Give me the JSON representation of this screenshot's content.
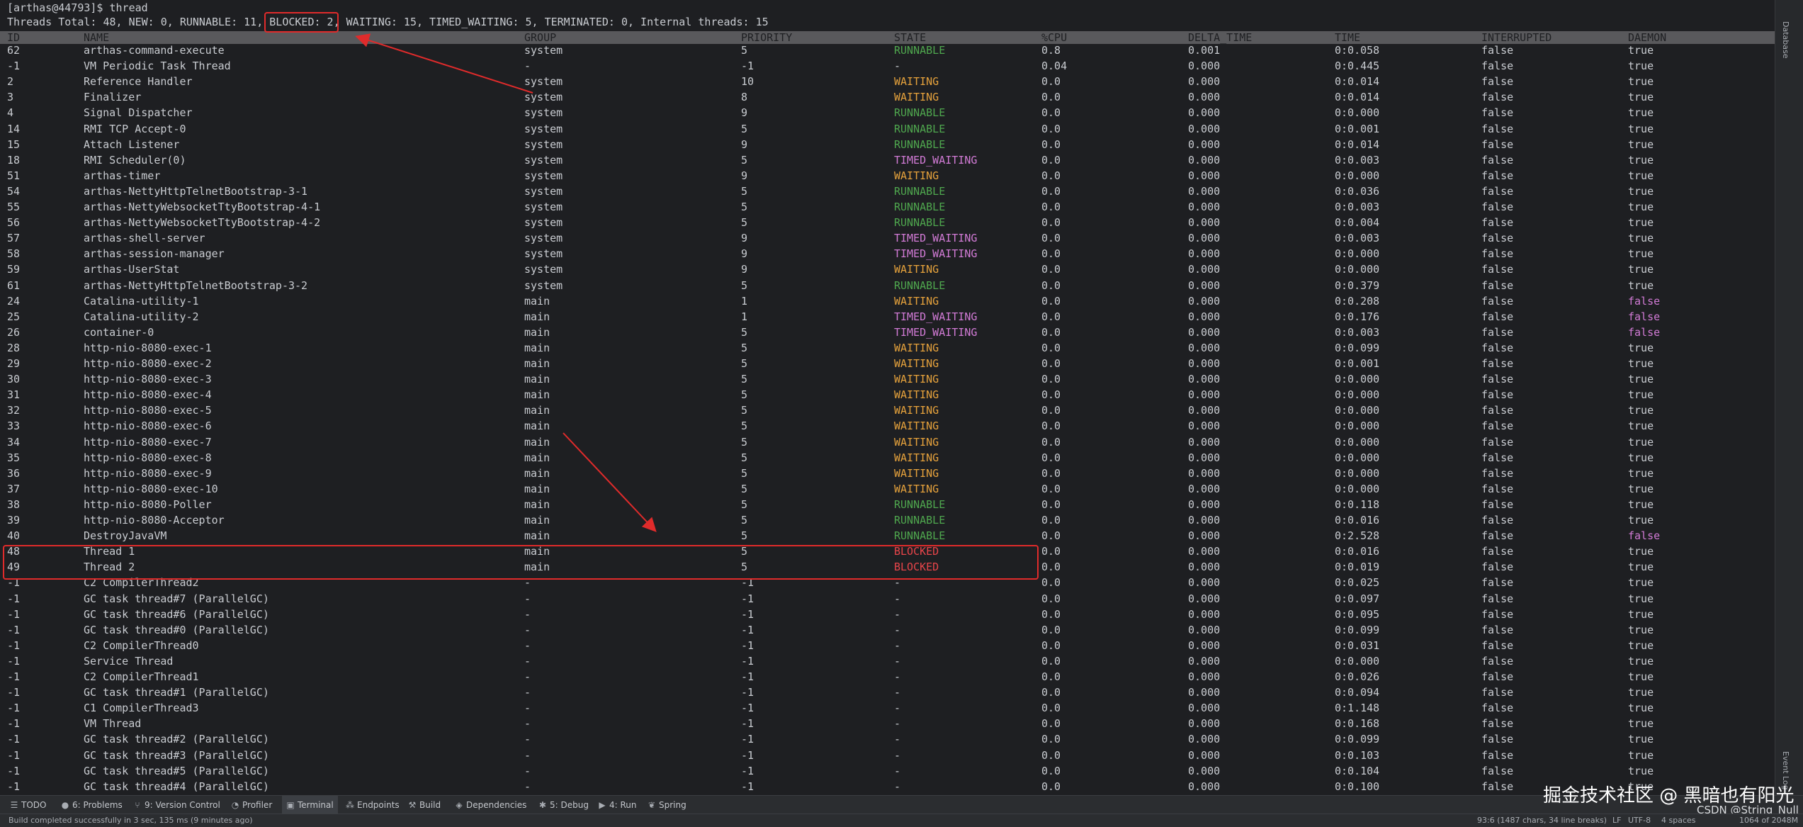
{
  "terminal": {
    "prompt": "[arthas@44793]$ thread",
    "summary": {
      "before": "Threads Total: 48, NEW: 0, RUNNABLE: 11, ",
      "blocked": "BLOCKED: 2",
      "after": ", WAITING: 15, TIMED_WAITING: 5, TERMINATED: 0, Internal threads: 15"
    },
    "columns": [
      "ID",
      "NAME",
      "GROUP",
      "PRIORITY",
      "STATE",
      "%CPU",
      "DELTA_TIME",
      "TIME",
      "INTERRUPTED",
      "DAEMON"
    ],
    "rows": [
      [
        "62",
        "arthas-command-execute",
        "system",
        "5",
        "RUNNABLE",
        "0.8",
        "0.001",
        "0:0.058",
        "false",
        "true"
      ],
      [
        "-1",
        "VM Periodic Task Thread",
        "-",
        "-1",
        "-",
        "0.04",
        "0.000",
        "0:0.445",
        "false",
        "true"
      ],
      [
        "2",
        "Reference Handler",
        "system",
        "10",
        "WAITING",
        "0.0",
        "0.000",
        "0:0.014",
        "false",
        "true"
      ],
      [
        "3",
        "Finalizer",
        "system",
        "8",
        "WAITING",
        "0.0",
        "0.000",
        "0:0.014",
        "false",
        "true"
      ],
      [
        "4",
        "Signal Dispatcher",
        "system",
        "9",
        "RUNNABLE",
        "0.0",
        "0.000",
        "0:0.000",
        "false",
        "true"
      ],
      [
        "14",
        "RMI TCP Accept-0",
        "system",
        "5",
        "RUNNABLE",
        "0.0",
        "0.000",
        "0:0.001",
        "false",
        "true"
      ],
      [
        "15",
        "Attach Listener",
        "system",
        "9",
        "RUNNABLE",
        "0.0",
        "0.000",
        "0:0.014",
        "false",
        "true"
      ],
      [
        "18",
        "RMI Scheduler(0)",
        "system",
        "5",
        "TIMED_WAITING",
        "0.0",
        "0.000",
        "0:0.003",
        "false",
        "true"
      ],
      [
        "51",
        "arthas-timer",
        "system",
        "9",
        "WAITING",
        "0.0",
        "0.000",
        "0:0.000",
        "false",
        "true"
      ],
      [
        "54",
        "arthas-NettyHttpTelnetBootstrap-3-1",
        "system",
        "5",
        "RUNNABLE",
        "0.0",
        "0.000",
        "0:0.036",
        "false",
        "true"
      ],
      [
        "55",
        "arthas-NettyWebsocketTtyBootstrap-4-1",
        "system",
        "5",
        "RUNNABLE",
        "0.0",
        "0.000",
        "0:0.003",
        "false",
        "true"
      ],
      [
        "56",
        "arthas-NettyWebsocketTtyBootstrap-4-2",
        "system",
        "5",
        "RUNNABLE",
        "0.0",
        "0.000",
        "0:0.004",
        "false",
        "true"
      ],
      [
        "57",
        "arthas-shell-server",
        "system",
        "9",
        "TIMED_WAITING",
        "0.0",
        "0.000",
        "0:0.003",
        "false",
        "true"
      ],
      [
        "58",
        "arthas-session-manager",
        "system",
        "9",
        "TIMED_WAITING",
        "0.0",
        "0.000",
        "0:0.000",
        "false",
        "true"
      ],
      [
        "59",
        "arthas-UserStat",
        "system",
        "9",
        "WAITING",
        "0.0",
        "0.000",
        "0:0.000",
        "false",
        "true"
      ],
      [
        "61",
        "arthas-NettyHttpTelnetBootstrap-3-2",
        "system",
        "5",
        "RUNNABLE",
        "0.0",
        "0.000",
        "0:0.379",
        "false",
        "true"
      ],
      [
        "24",
        "Catalina-utility-1",
        "main",
        "1",
        "WAITING",
        "0.0",
        "0.000",
        "0:0.208",
        "false",
        "false"
      ],
      [
        "25",
        "Catalina-utility-2",
        "main",
        "1",
        "TIMED_WAITING",
        "0.0",
        "0.000",
        "0:0.176",
        "false",
        "false"
      ],
      [
        "26",
        "container-0",
        "main",
        "5",
        "TIMED_WAITING",
        "0.0",
        "0.000",
        "0:0.003",
        "false",
        "false"
      ],
      [
        "28",
        "http-nio-8080-exec-1",
        "main",
        "5",
        "WAITING",
        "0.0",
        "0.000",
        "0:0.099",
        "false",
        "true"
      ],
      [
        "29",
        "http-nio-8080-exec-2",
        "main",
        "5",
        "WAITING",
        "0.0",
        "0.000",
        "0:0.001",
        "false",
        "true"
      ],
      [
        "30",
        "http-nio-8080-exec-3",
        "main",
        "5",
        "WAITING",
        "0.0",
        "0.000",
        "0:0.000",
        "false",
        "true"
      ],
      [
        "31",
        "http-nio-8080-exec-4",
        "main",
        "5",
        "WAITING",
        "0.0",
        "0.000",
        "0:0.000",
        "false",
        "true"
      ],
      [
        "32",
        "http-nio-8080-exec-5",
        "main",
        "5",
        "WAITING",
        "0.0",
        "0.000",
        "0:0.000",
        "false",
        "true"
      ],
      [
        "33",
        "http-nio-8080-exec-6",
        "main",
        "5",
        "WAITING",
        "0.0",
        "0.000",
        "0:0.000",
        "false",
        "true"
      ],
      [
        "34",
        "http-nio-8080-exec-7",
        "main",
        "5",
        "WAITING",
        "0.0",
        "0.000",
        "0:0.000",
        "false",
        "true"
      ],
      [
        "35",
        "http-nio-8080-exec-8",
        "main",
        "5",
        "WAITING",
        "0.0",
        "0.000",
        "0:0.000",
        "false",
        "true"
      ],
      [
        "36",
        "http-nio-8080-exec-9",
        "main",
        "5",
        "WAITING",
        "0.0",
        "0.000",
        "0:0.000",
        "false",
        "true"
      ],
      [
        "37",
        "http-nio-8080-exec-10",
        "main",
        "5",
        "WAITING",
        "0.0",
        "0.000",
        "0:0.000",
        "false",
        "true"
      ],
      [
        "38",
        "http-nio-8080-Poller",
        "main",
        "5",
        "RUNNABLE",
        "0.0",
        "0.000",
        "0:0.118",
        "false",
        "true"
      ],
      [
        "39",
        "http-nio-8080-Acceptor",
        "main",
        "5",
        "RUNNABLE",
        "0.0",
        "0.000",
        "0:0.016",
        "false",
        "true"
      ],
      [
        "40",
        "DestroyJavaVM",
        "main",
        "5",
        "RUNNABLE",
        "0.0",
        "0.000",
        "0:2.528",
        "false",
        "false"
      ],
      [
        "48",
        "Thread 1",
        "main",
        "5",
        "BLOCKED",
        "0.0",
        "0.000",
        "0:0.016",
        "false",
        "true"
      ],
      [
        "49",
        "Thread 2",
        "main",
        "5",
        "BLOCKED",
        "0.0",
        "0.000",
        "0:0.019",
        "false",
        "true"
      ],
      [
        "-1",
        "C2 CompilerThread2",
        "-",
        "-1",
        "-",
        "0.0",
        "0.000",
        "0:0.025",
        "false",
        "true"
      ],
      [
        "-1",
        "GC task thread#7 (ParallelGC)",
        "-",
        "-1",
        "-",
        "0.0",
        "0.000",
        "0:0.097",
        "false",
        "true"
      ],
      [
        "-1",
        "GC task thread#6 (ParallelGC)",
        "-",
        "-1",
        "-",
        "0.0",
        "0.000",
        "0:0.095",
        "false",
        "true"
      ],
      [
        "-1",
        "GC task thread#0 (ParallelGC)",
        "-",
        "-1",
        "-",
        "0.0",
        "0.000",
        "0:0.099",
        "false",
        "true"
      ],
      [
        "-1",
        "C2 CompilerThread0",
        "-",
        "-1",
        "-",
        "0.0",
        "0.000",
        "0:0.031",
        "false",
        "true"
      ],
      [
        "-1",
        "Service Thread",
        "-",
        "-1",
        "-",
        "0.0",
        "0.000",
        "0:0.000",
        "false",
        "true"
      ],
      [
        "-1",
        "C2 CompilerThread1",
        "-",
        "-1",
        "-",
        "0.0",
        "0.000",
        "0:0.026",
        "false",
        "true"
      ],
      [
        "-1",
        "GC task thread#1 (ParallelGC)",
        "-",
        "-1",
        "-",
        "0.0",
        "0.000",
        "0:0.094",
        "false",
        "true"
      ],
      [
        "-1",
        "C1 CompilerThread3",
        "-",
        "-1",
        "-",
        "0.0",
        "0.000",
        "0:1.148",
        "false",
        "true"
      ],
      [
        "-1",
        "VM Thread",
        "-",
        "-1",
        "-",
        "0.0",
        "0.000",
        "0:0.168",
        "false",
        "true"
      ],
      [
        "-1",
        "GC task thread#2 (ParallelGC)",
        "-",
        "-1",
        "-",
        "0.0",
        "0.000",
        "0:0.099",
        "false",
        "true"
      ],
      [
        "-1",
        "GC task thread#3 (ParallelGC)",
        "-",
        "-1",
        "-",
        "0.0",
        "0.000",
        "0:0.103",
        "false",
        "true"
      ],
      [
        "-1",
        "GC task thread#5 (ParallelGC)",
        "-",
        "-1",
        "-",
        "0.0",
        "0.000",
        "0:0.104",
        "false",
        "true"
      ],
      [
        "-1",
        "GC task thread#4 (ParallelGC)",
        "-",
        "-1",
        "-",
        "0.0",
        "0.000",
        "0:0.100",
        "false",
        "true"
      ]
    ]
  },
  "toolbar": {
    "items": [
      {
        "icon": "list-icon",
        "label": "TODO"
      },
      {
        "icon": "problems-icon",
        "label": "6: Problems"
      },
      {
        "icon": "branch-icon",
        "label": "9: Version Control"
      },
      {
        "icon": "profiler-icon",
        "label": "Profiler"
      },
      {
        "icon": "terminal-icon",
        "label": "Terminal"
      },
      {
        "icon": "endpoints-icon",
        "label": "Endpoints"
      },
      {
        "icon": "build-icon",
        "label": "Build"
      },
      {
        "icon": "dependencies-icon",
        "label": "Dependencies"
      },
      {
        "icon": "debug-icon",
        "label": "5: Debug"
      },
      {
        "icon": "run-icon",
        "label": "4: Run"
      },
      {
        "icon": "spring-icon",
        "label": "Spring"
      }
    ]
  },
  "statusbar": {
    "message": "Build completed successfully in 3 sec, 135 ms (9 minutes ago)",
    "position": "93:6 (1487 chars, 34 line breaks)",
    "line_ending": "LF",
    "encoding": "UTF-8",
    "indent": "4 spaces",
    "memory": "1064 of 2048M"
  },
  "sidebar": {
    "top_tab": "Database",
    "event_log": "Event Log"
  },
  "watermark": {
    "main": "掘金技术社区 @ 黑暗也有阳光",
    "sub": "CSDN @String_Null"
  },
  "colors": {
    "background": "#1e1f22",
    "text": "#c9ccd1",
    "runnable": "#4fa74e",
    "waiting": "#e6a23c",
    "timed_waiting": "#d27bd6",
    "blocked": "#e8454a",
    "annotation": "#e02b2b"
  }
}
